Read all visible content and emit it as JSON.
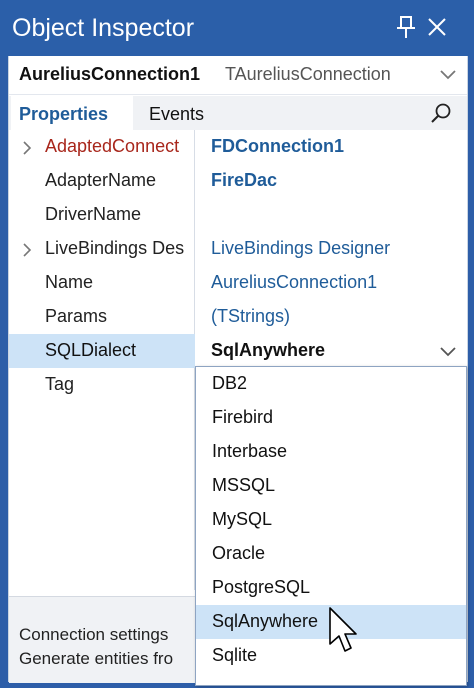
{
  "window": {
    "title": "Object Inspector"
  },
  "object_selector": {
    "name": "AureliusConnection1",
    "type": "TAureliusConnection"
  },
  "tabs": [
    {
      "label": "Properties"
    },
    {
      "label": "Events"
    }
  ],
  "properties": [
    {
      "name": "AdaptedConnect",
      "value": "FDConnection1",
      "expandable": true
    },
    {
      "name": "AdapterName",
      "value": "FireDac",
      "expandable": false
    },
    {
      "name": "DriverName",
      "value": "",
      "expandable": false
    },
    {
      "name": "LiveBindings Des",
      "value": "LiveBindings Designer",
      "expandable": true
    },
    {
      "name": "Name",
      "value": "AureliusConnection1",
      "expandable": false
    },
    {
      "name": "Params",
      "value": "(TStrings)",
      "expandable": false
    },
    {
      "name": "SQLDialect",
      "value": "SqlAnywhere",
      "expandable": false
    },
    {
      "name": "Tag",
      "value": "",
      "expandable": false
    }
  ],
  "dialect_options": [
    "DB2",
    "Firebird",
    "Interbase",
    "MSSQL",
    "MySQL",
    "Oracle",
    "PostgreSQL",
    "SqlAnywhere",
    "Sqlite"
  ],
  "description": {
    "line1": "Connection settings",
    "line2": "Generate entities fro"
  },
  "colors": {
    "titlebar": "#2b5fa9",
    "accent": "#1f5c99",
    "selection": "#cde3f7",
    "red_name": "#a8261b"
  }
}
